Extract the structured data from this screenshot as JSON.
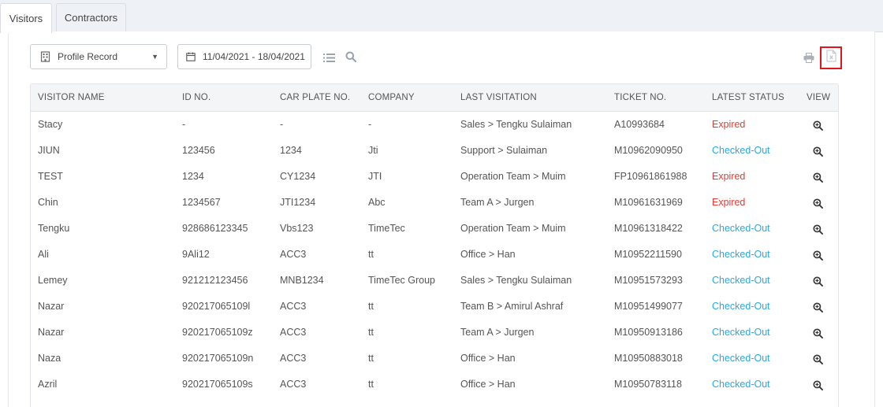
{
  "tabs": [
    {
      "label": "Visitors",
      "active": true
    },
    {
      "label": "Contractors",
      "active": false
    }
  ],
  "toolbar": {
    "record_select": {
      "value": "Profile Record",
      "icon": "building-icon"
    },
    "date_range": {
      "value": "11/04/2021 - 18/04/2021",
      "icon": "calendar-icon"
    },
    "list_icon": "list-icon",
    "search_icon": "search-icon",
    "print_icon": "printer-icon",
    "export_icon": "excel-export-icon"
  },
  "colors": {
    "expired": "#e53935",
    "checked_out": "#29a8e0",
    "highlight": "#e0161b",
    "header_bg": "#f4f5f7"
  },
  "table": {
    "headers": [
      "VISITOR NAME",
      "ID NO.",
      "CAR PLATE NO.",
      "COMPANY",
      "LAST VISITATION",
      "TICKET NO.",
      "LATEST STATUS",
      "VIEW"
    ],
    "rows": [
      {
        "name": "Stacy",
        "id": "-",
        "plate": "-",
        "company": "-",
        "visitation": "Sales > Tengku Sulaiman",
        "ticket": "A10993684",
        "status": "Expired"
      },
      {
        "name": "JIUN",
        "id": "123456",
        "plate": "1234",
        "company": "Jti",
        "visitation": "Support > Sulaiman",
        "ticket": "M10962090950",
        "status": "Checked-Out"
      },
      {
        "name": "TEST",
        "id": "1234",
        "plate": "CY1234",
        "company": "JTI",
        "visitation": "Operation Team > Muim",
        "ticket": "FP10961861988",
        "status": "Expired"
      },
      {
        "name": "Chin",
        "id": "1234567",
        "plate": "JTI1234",
        "company": "Abc",
        "visitation": "Team A > Jurgen",
        "ticket": "M10961631969",
        "status": "Expired"
      },
      {
        "name": "Tengku",
        "id": "928686123345",
        "plate": "Vbs123",
        "company": "TimeTec",
        "visitation": "Operation Team > Muim",
        "ticket": "M10961318422",
        "status": "Checked-Out"
      },
      {
        "name": "Ali",
        "id": "9Ali12",
        "plate": "ACC3",
        "company": "tt",
        "visitation": "Office > Han",
        "ticket": "M10952211590",
        "status": "Checked-Out"
      },
      {
        "name": "Lemey",
        "id": "921212123456",
        "plate": "MNB1234",
        "company": "TimeTec Group",
        "visitation": "Sales > Tengku Sulaiman",
        "ticket": "M10951573293",
        "status": "Checked-Out"
      },
      {
        "name": "Nazar",
        "id": "920217065109l",
        "plate": "ACC3",
        "company": "tt",
        "visitation": "Team B > Amirul Ashraf",
        "ticket": "M10951499077",
        "status": "Checked-Out"
      },
      {
        "name": "Nazar",
        "id": "920217065109z",
        "plate": "ACC3",
        "company": "tt",
        "visitation": "Team A > Jurgen",
        "ticket": "M10950913186",
        "status": "Checked-Out"
      },
      {
        "name": "Naza",
        "id": "920217065109n",
        "plate": "ACC3",
        "company": "tt",
        "visitation": "Office > Han",
        "ticket": "M10950883018",
        "status": "Checked-Out"
      },
      {
        "name": "Azril",
        "id": "920217065109s",
        "plate": "ACC3",
        "company": "tt",
        "visitation": "Office > Han",
        "ticket": "M10950783118",
        "status": "Checked-Out"
      }
    ]
  }
}
